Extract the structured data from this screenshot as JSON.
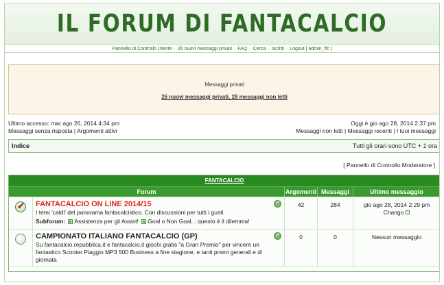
{
  "header": {
    "logo_text": "IL FORUM DI FANTACALCIO"
  },
  "navbar": {
    "items": [
      "Pannello di Controllo Utente",
      "26 nuovi messaggi privati",
      "FAQ",
      "Cerca",
      "Iscritti",
      "Logout [ admin_ffc ]"
    ],
    "separator": "·"
  },
  "pm_box": {
    "title": "Messaggi privati",
    "link": "26 nuovi messaggi privati, 28 messaggi non letti"
  },
  "access": {
    "last_visit": "Ultimo accesso: mar ago 26, 2014 4:34 pm",
    "left_links": [
      "Messaggi senza risposta",
      "Argomenti attivi"
    ],
    "current_date": "Oggi è gio ago 28, 2014 2:37 pm",
    "right_links": [
      "Messaggi non letti",
      "Messaggi recenti",
      "I tuoi messaggi"
    ],
    "link_separator": " | "
  },
  "breadcrumb": {
    "index": "Indice",
    "timezone": "Tutti gli orari sono UTC + 1 ora"
  },
  "moderator": {
    "link": "[ Pannello di Controllo Moderatore ]"
  },
  "category": {
    "title": "FANTACALCIO",
    "columns": {
      "forum": "Forum",
      "topics": "Argomenti",
      "posts": "Messaggi",
      "last_post": "Ultimo messaggio"
    },
    "forums": [
      {
        "title": "FANTACALCIO ON LINE 2014/15",
        "hot": true,
        "new_posts": true,
        "description": "I temi 'caldi' del panorama fantacalcistico. Con discussioni per tutti i gusti.",
        "subforum_label": "Subforum:",
        "subforums": [
          "Assistenza per gli Assist!",
          "Goal o Non Goal... questo è il dilemma!"
        ],
        "topics": "42",
        "posts": "284",
        "last_post_date": "gio ago 28, 2014 2:29 pm",
        "last_post_user": "Chango"
      },
      {
        "title": "CAMPIONATO ITALIANO FANTACALCIO (GP)",
        "hot": false,
        "new_posts": false,
        "description": "Su fantacalcio.repubblica.it e fantacalcio.it giochi gratis \"a Gran Premio\" per vincere un fantastico Scooter Piaggio MP3 500 Business a fine stagione, e tanti premi generali e di giornata",
        "topics": "0",
        "posts": "0",
        "last_post_date": "Nessun messaggio"
      }
    ]
  },
  "colors": {
    "brand_green": "#2e6b24",
    "category_green": "#2a8a22",
    "hot_red": "#e3231c",
    "pm_border": "#e2b98c"
  }
}
